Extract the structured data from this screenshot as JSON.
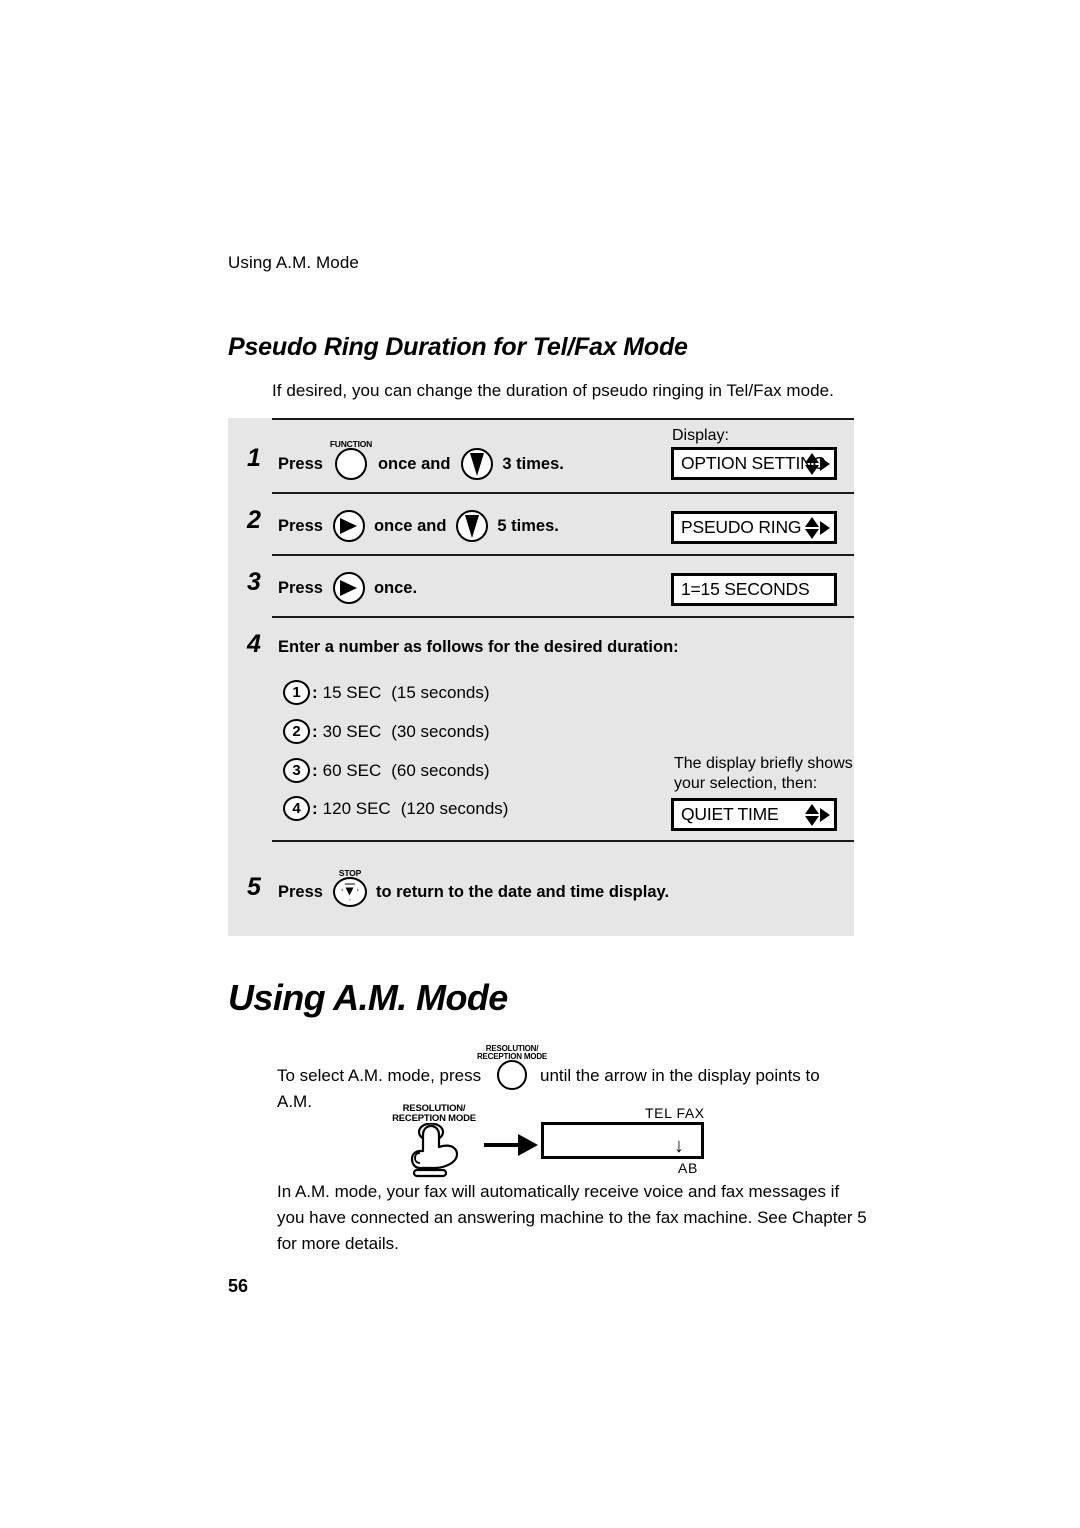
{
  "running_head": "Using A.M. Mode",
  "section": {
    "heading": "Pseudo Ring Duration for Tel/Fax Mode",
    "intro": "If desired, you can change the duration of pseudo ringing in Tel/Fax mode."
  },
  "display_column": {
    "label": "Display:",
    "note_line1": "The display briefly shows",
    "note_line2": "your selection, then:"
  },
  "steps": [
    {
      "number": "1",
      "press_label": "Press",
      "key1_label": "FUNCTION",
      "key1_icon": "blank-round-button-icon",
      "mid_text": "once  and",
      "key2_icon": "down-arrow-button-icon",
      "tail_text": "3 times.",
      "lcd": "OPTION SETTING",
      "lcd_has_arrows": true
    },
    {
      "number": "2",
      "press_label": "Press",
      "key1_icon": "right-arrow-button-icon",
      "mid_text": "once and",
      "key2_icon": "down-arrow-button-icon",
      "tail_text": "5 times.",
      "lcd": "PSEUDO RING",
      "lcd_has_arrows": true
    },
    {
      "number": "3",
      "press_label": "Press",
      "key1_icon": "right-arrow-button-icon",
      "tail_text": "once.",
      "lcd": "1=15 SECONDS",
      "lcd_has_arrows": false
    },
    {
      "number": "4",
      "instruction": "Enter a number as follows for the desired duration:",
      "options": [
        {
          "key": "1",
          "value": "15 SEC",
          "paren": "(15 seconds)"
        },
        {
          "key": "2",
          "value": "30 SEC",
          "paren": "(30 seconds)"
        },
        {
          "key": "3",
          "value": "60 SEC",
          "paren": "(60 seconds)"
        },
        {
          "key": "4",
          "value": "120 SEC",
          "paren": "(120 seconds)"
        }
      ],
      "lcd": "QUIET TIME",
      "lcd_has_arrows": true
    },
    {
      "number": "5",
      "press_label": "Press",
      "key1_label": "STOP",
      "key1_icon": "stop-button-icon",
      "tail_text": "to return to the date and time display."
    }
  ],
  "chapter": {
    "title": "Using A.M. Mode",
    "para1_before": "To select A.M. mode, press",
    "para1_key_label_line1": "RESOLUTION/",
    "para1_key_label_line2": "RECEPTION MODE",
    "para1_after": "until the arrow in the display points to",
    "para1_second_line": "A.M.",
    "figure": {
      "key_label_line1": "RESOLUTION/",
      "key_label_line2": "RECEPTION MODE",
      "hand_icon": "pointing-hand-icon",
      "arrow_icon": "right-arrow-icon",
      "display_top_label": "TEL  FAX",
      "display_pointer": "↓",
      "display_bottom_label": "AB"
    },
    "para2_line1": "In A.M. mode, your fax will automatically receive voice and fax messages if",
    "para2_line2": "you have connected an answering machine to the fax machine. See Chapter 5",
    "para2_line3": "for more details."
  },
  "page_number": "56",
  "colors": {
    "panel_bg": "#e6e6e6",
    "ink": "#000000",
    "paper": "#ffffff"
  }
}
